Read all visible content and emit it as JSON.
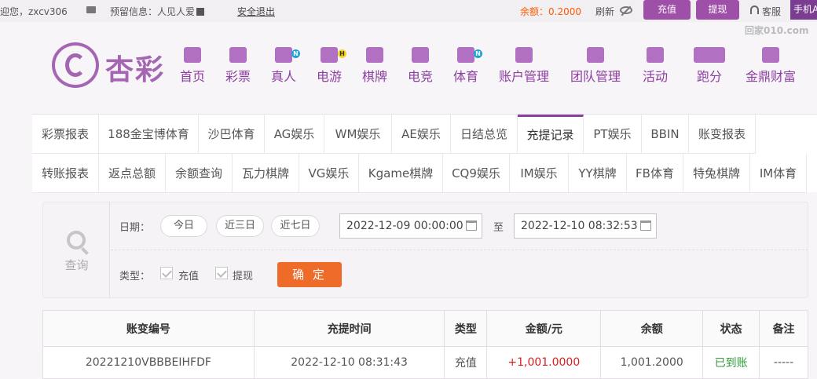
{
  "topbar": {
    "welcome": "迎您，zxcv306",
    "reserved": "预留信息：人见人爱",
    "logout": "安全退出",
    "balance": "余额：0.2000",
    "refresh": "刷新",
    "recharge": "充值",
    "withdraw": "提现",
    "service": "客服",
    "mobile": "手机A",
    "watermark": "回家010.com"
  },
  "logo": {
    "text": "杏彩"
  },
  "nav": [
    {
      "label": "首页",
      "icon": "home-icon"
    },
    {
      "label": "彩票",
      "icon": "lottery-icon"
    },
    {
      "label": "真人",
      "icon": "live-dealer-icon",
      "badge": "N"
    },
    {
      "label": "电游",
      "icon": "gamepad-icon",
      "badge": "H"
    },
    {
      "label": "棋牌",
      "icon": "cards-icon"
    },
    {
      "label": "电竞",
      "icon": "esports-icon"
    },
    {
      "label": "体育",
      "icon": "trophy-icon",
      "badge": "N"
    },
    {
      "label": "账户管理",
      "icon": "yen-icon"
    },
    {
      "label": "团队管理",
      "icon": "team-icon"
    },
    {
      "label": "活动",
      "icon": "gift-icon"
    },
    {
      "label": "跑分",
      "icon": "car-icon"
    },
    {
      "label": "金鼎财富",
      "icon": "treasure-icon"
    }
  ],
  "tabs_row1": [
    "彩票报表",
    "188金宝博体育",
    "沙巴体育",
    "AG娱乐",
    "WM娱乐",
    "AE娱乐",
    "日结总览",
    "充提记录",
    "PT娱乐",
    "BBIN",
    "账变报表"
  ],
  "tabs_row2": [
    "转账报表",
    "返点总额",
    "余额查询",
    "瓦力棋牌",
    "VG娱乐",
    "Kgame棋牌",
    "CQ9娱乐",
    "IM娱乐",
    "YY棋牌",
    "FB体育",
    "特兔棋牌",
    "IM体育"
  ],
  "filter": {
    "search_label": "查询",
    "date_label": "日期：",
    "chips": [
      "今日",
      "近三日",
      "近七日"
    ],
    "start_date": "2022-12-09 00:00:00",
    "to": "至",
    "end_date": "2022-12-10 08:32:53",
    "type_label": "类型：",
    "type_recharge": "充值",
    "type_withdraw": "提现",
    "confirm": "确 定"
  },
  "table": {
    "headers": [
      "账变编号",
      "充提时间",
      "类型",
      "金额/元",
      "余额",
      "状态",
      "备注"
    ],
    "rows": [
      [
        "20221210VBBBEIHFDF",
        "2022-12-10 08:31:43",
        "充值",
        "+1,001.0000",
        "1,001.2000",
        "已到账",
        "-----"
      ]
    ]
  },
  "colors": {
    "brand": "#8c3fa0",
    "accent": "#ef6b2a",
    "amount": "#d81f1f",
    "success": "#2f9a36"
  }
}
